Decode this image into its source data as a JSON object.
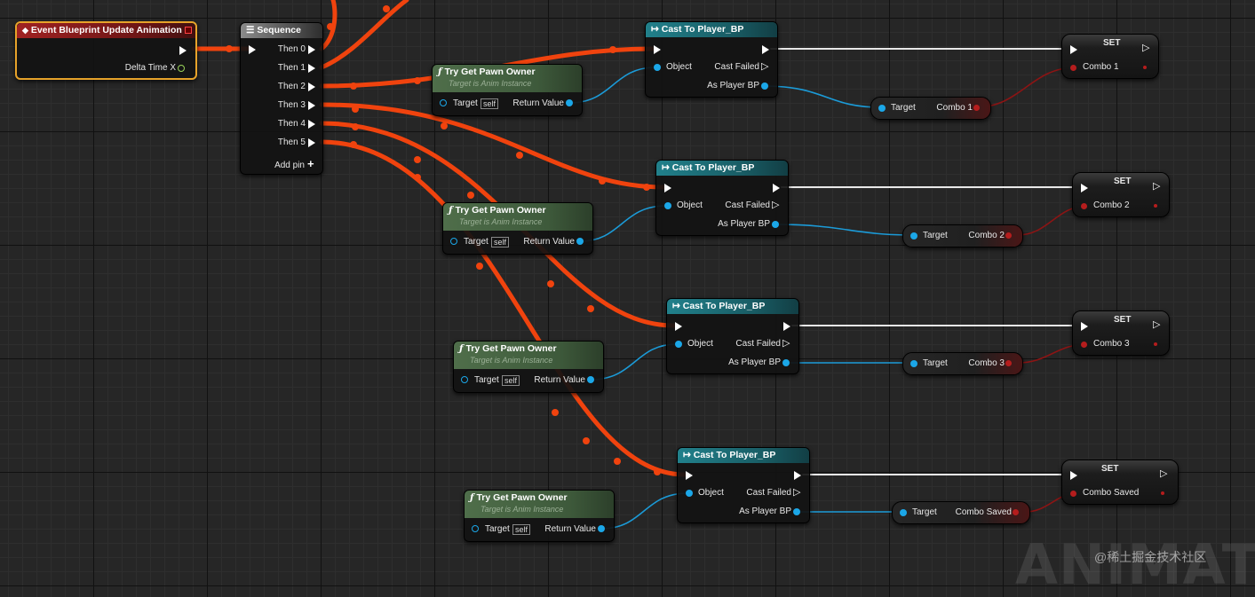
{
  "event": {
    "title": "Event Blueprint Update Animation",
    "delta_label": "Delta Time X"
  },
  "sequence": {
    "title": "Sequence",
    "pins": [
      "Then 0",
      "Then 1",
      "Then 2",
      "Then 3",
      "Then 4",
      "Then 5"
    ],
    "add_pin": "Add pin"
  },
  "pawn_owner": {
    "title": "Try Get Pawn Owner",
    "subtitle": "Target is Anim Instance",
    "target": "Target",
    "self": "self",
    "return": "Return Value"
  },
  "cast": {
    "title": "Cast To Player_BP",
    "object": "Object",
    "failed": "Cast Failed",
    "as_player": "As Player BP"
  },
  "getters": [
    {
      "target": "Target",
      "var": "Combo 1"
    },
    {
      "target": "Target",
      "var": "Combo 2"
    },
    {
      "target": "Target",
      "var": "Combo 3"
    },
    {
      "target": "Target",
      "var": "Combo Saved"
    }
  ],
  "setters": [
    {
      "title": "SET",
      "var": "Combo 1"
    },
    {
      "title": "SET",
      "var": "Combo 2"
    },
    {
      "title": "SET",
      "var": "Combo 3"
    },
    {
      "title": "SET",
      "var": "Combo Saved"
    }
  ],
  "watermark": {
    "big": "ANIMATIO",
    "small": "@稀土掘金技术社区"
  },
  "colors": {
    "exec_wire": "#f0430e",
    "object_wire": "#1b9bd8",
    "bool_wire": "#8c1414",
    "exec_white": "#ffffff"
  },
  "icons": {
    "event": "event-diamond-icon",
    "sequence": "sequence-icon",
    "cast": "cast-arrow-icon",
    "function": "function-f-icon",
    "add": "plus-icon"
  }
}
